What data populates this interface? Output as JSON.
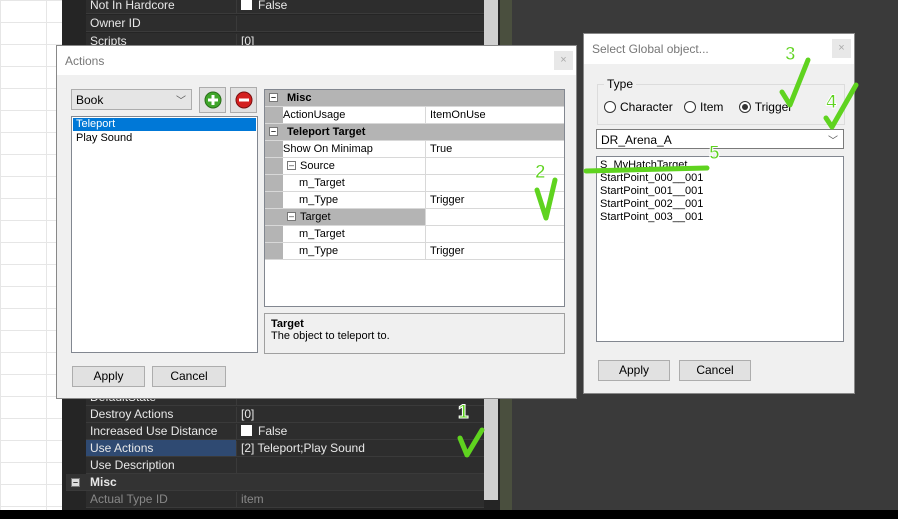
{
  "background_grid": {
    "top_rows": [
      {
        "name": "Not In Hardcore",
        "value": "False",
        "checkbox": true
      },
      {
        "name": "Owner ID",
        "value": ""
      },
      {
        "name": "Scripts",
        "value": "[0]"
      }
    ],
    "bottom_rows": [
      {
        "name": "DefaultState",
        "value": ""
      },
      {
        "name": "Destroy Actions",
        "value": "[0]"
      },
      {
        "name": "Increased Use Distance",
        "value": "False",
        "checkbox": true
      },
      {
        "name": "Use Actions",
        "value": "[2] Teleport;Play Sound",
        "selected": true
      },
      {
        "name": "Use Description",
        "value": ""
      }
    ],
    "misc_category": "Misc",
    "misc_rows": [
      {
        "name": "Actual Type ID",
        "value": "item"
      }
    ]
  },
  "actions_dialog": {
    "title": "Actions",
    "close": "×",
    "type_combo": "Book",
    "actions": [
      "Teleport",
      "Play Sound"
    ],
    "selected_action": "Teleport",
    "properties": {
      "cat_misc": "Misc",
      "action_usage": {
        "name": "ActionUsage",
        "value": "ItemOnUse"
      },
      "cat_teleport": "Teleport Target",
      "show_on_minimap": {
        "name": "Show On Minimap",
        "value": "True"
      },
      "source": "Source",
      "source_target": {
        "name": "m_Target",
        "value": ""
      },
      "source_type": {
        "name": "m_Type",
        "value": "Trigger"
      },
      "target": "Target",
      "target_target": {
        "name": "m_Target",
        "value": ""
      },
      "target_type": {
        "name": "m_Type",
        "value": "Trigger"
      }
    },
    "description_title": "Target",
    "description_text": "The object to teleport to.",
    "apply": "Apply",
    "cancel": "Cancel"
  },
  "global_dialog": {
    "title": "Select Global object...",
    "close": "×",
    "type_label": "Type",
    "radios": [
      "Character",
      "Item",
      "Trigger"
    ],
    "selected_radio": "Trigger",
    "level_combo": "DR_Arena_A",
    "objects": [
      "S_MyHatchTarget",
      "StartPoint_000__001",
      "StartPoint_001__001",
      "StartPoint_002__001",
      "StartPoint_003__001"
    ],
    "apply": "Apply",
    "cancel": "Cancel"
  },
  "annotations": [
    "1",
    "2",
    "3",
    "4",
    "5"
  ],
  "annotation_color": "#5fd31f"
}
